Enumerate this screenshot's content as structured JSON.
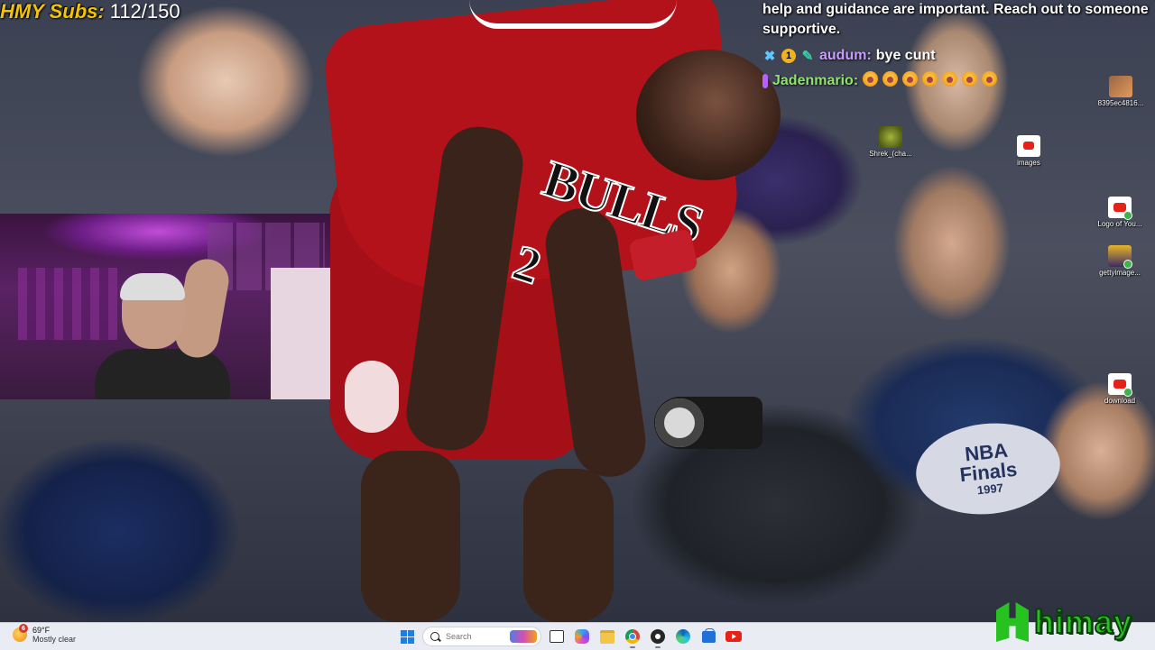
{
  "overlay": {
    "subs_label": "HMY Subs:",
    "subs_count": "112/150"
  },
  "scene": {
    "jersey_text": "BULLS",
    "jersey_number": "2",
    "badge_line1": "NBA",
    "badge_line2": "Finals",
    "badge_line3": "1997"
  },
  "chat": {
    "line1": "help and guidance are important. Reach out to someone",
    "line2": "supportive.",
    "msg1_user": "audum:",
    "msg1_text": "bye cunt",
    "msg2_user": "Jadenmario:"
  },
  "desktop_icons": [
    {
      "label": "8395ec4816...",
      "icon": "image-file-icon"
    },
    {
      "label": "Shrek_(cha...",
      "icon": "shrek-icon"
    },
    {
      "label": "images",
      "icon": "youtube-image-icon"
    },
    {
      "label": "Logo of You...",
      "icon": "youtube-logo-icon"
    },
    {
      "label": "gettyimage...",
      "icon": "getty-image-icon"
    },
    {
      "label": "download",
      "icon": "youtube-download-icon"
    }
  ],
  "taskbar": {
    "weather_temp": "69°F",
    "weather_condition": "Mostly clear",
    "weather_badge": "6",
    "search_placeholder": "Search"
  },
  "brand": {
    "logo_text": "himay",
    "accent": "#27c21f"
  }
}
